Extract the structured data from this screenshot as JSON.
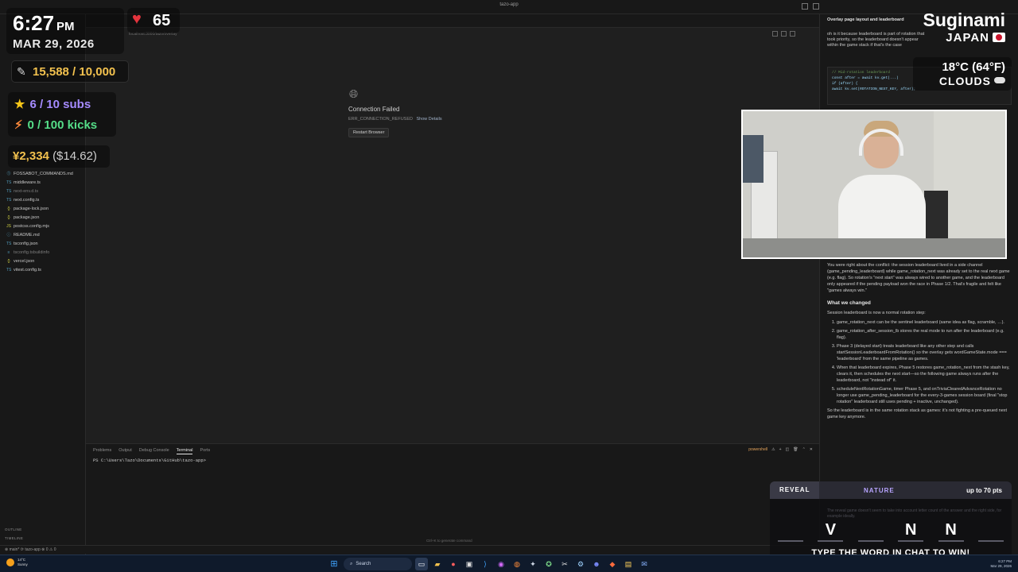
{
  "window": {
    "title": "tazo-app"
  },
  "explorer": {
    "files": [
      {
        "icon": "markdown-icon",
        "cls": "md",
        "glyph": "⓵",
        "name": "FOSSABOT_COMMANDS.md",
        "dim": false
      },
      {
        "icon": "typescript-icon",
        "cls": "ts",
        "glyph": "TS",
        "name": "middleware.ts",
        "dim": false
      },
      {
        "icon": "typescript-icon",
        "cls": "dts",
        "glyph": "TS",
        "name": "next-env.d.ts",
        "dim": true
      },
      {
        "icon": "typescript-icon",
        "cls": "ts",
        "glyph": "TS",
        "name": "next.config.ts",
        "dim": false
      },
      {
        "icon": "json-icon",
        "cls": "json",
        "glyph": "{}",
        "name": "package-lock.json",
        "dim": false
      },
      {
        "icon": "json-icon",
        "cls": "json",
        "glyph": "{}",
        "name": "package.json",
        "dim": false
      },
      {
        "icon": "js-icon",
        "cls": "mjs",
        "glyph": "JS",
        "name": "postcss.config.mjs",
        "dim": false
      },
      {
        "icon": "markdown-icon",
        "cls": "md",
        "glyph": "ⓘ",
        "name": "README.md",
        "dim": false
      },
      {
        "icon": "typescript-icon",
        "cls": "ts",
        "glyph": "TS",
        "name": "tsconfig.json",
        "dim": false
      },
      {
        "icon": "file-icon",
        "cls": "dts",
        "glyph": "≡",
        "name": "tsconfig.tsbuildinfo",
        "dim": true
      },
      {
        "icon": "json-icon",
        "cls": "json",
        "glyph": "{}",
        "name": "vercel.json",
        "dim": false
      },
      {
        "icon": "typescript-icon",
        "cls": "ts",
        "glyph": "TS",
        "name": "vitest.config.ts",
        "dim": false
      }
    ],
    "outline_label": "OUTLINE",
    "timeline_label": "TIMELINE"
  },
  "browser": {
    "url": "localhost:3000/tazo/overlay",
    "error_title": "Connection Failed",
    "error_code": "ERR_CONNECTION_REFUSED",
    "details_link": "Show Details",
    "restart_button": "Restart Browser"
  },
  "panel": {
    "tabs": [
      "Problems",
      "Output",
      "Debug Console",
      "Terminal",
      "Ports"
    ],
    "active_tab": "Terminal",
    "shell": "powershell",
    "prompt": "PS C:\\Users\\Tazo\\Documents\\GitHub\\tazo-app>",
    "hint": "Ctrl+K to generate command"
  },
  "statusbar": {
    "left": "⊗ main* ⟳  tazo-app  ⊗ 0 ⚠ 0"
  },
  "chat": {
    "header": "Overlay page layout and leaderboard",
    "message1": "oh is it because leaderboard is part of rotation that took priority, so the leaderboard doesn't appear within the game stack if that's the case",
    "code_comment": "// Mid-rotation leaderboard",
    "code_l1": "const after = await kv.get(...)",
    "code_l2": "if (after) {",
    "code_l3": "  await kv.set(ROTATION_NEXT_KEY, after);",
    "p1": "You were right about the conflict: the session leaderboard lived in a side channel (game_pending_leaderboard) while game_rotation_next was already set to the real next game (e.g. flag). So rotation's \"next start\" was always wired to another game, and the leaderboard only appeared if the pending payload won the race in Phase 1/2. That's fragile and felt like \"games always win.\"",
    "h_changed": "What we changed",
    "p2": "Session leaderboard is now a normal rotation step:",
    "items": [
      "game_rotation_next can be the sentinel leaderboard (same idea as flag, scramble, …).",
      "game_rotation_after_session_lb stores the real mode to run after the leaderboard (e.g. flag).",
      "Phase 3 (delayed start) treats leaderboard like any other step and calls startSessionLeaderboardFromRotation() so the overlay gets wordGameState.mode === 'leaderboard' from the same pipeline as games.",
      "When that leaderboard expires, Phase 5 restores game_rotation_next from the stash key, clears it, then schedules the next start—so the following game always runs after the leaderboard, not \"instead of\" it.",
      "scheduleNextRotationGame, timer Phase 5, and onTriviaClearedAdvanceRotation no longer use game_pending_leaderboard for the every-3-games session board (final \"stop rotation\" leaderboard still uses pending + inactive, unchanged)."
    ],
    "p3": "So the leaderboard is in the same rotation stack as games: it's not fighting a pre-queued next game key anymore."
  },
  "overlay": {
    "time": "6:27",
    "ampm": "PM",
    "date": "MAR 29, 2026",
    "heart_rate": "65",
    "goal": "15,588 / 10,000",
    "subs": "6 / 10 subs",
    "kicks": "0 / 100 kicks",
    "money": "¥2,334",
    "money_usd": "($14.62)",
    "name": "Suginami",
    "country": "JAPAN",
    "temp": "18°C (64°F)",
    "condition": "CLOUDS"
  },
  "game": {
    "mode": "REVEAL",
    "category": "NATURE",
    "points": "up to 70 pts",
    "hint": "The reveal game doesn't seem to take into account letter count of the answer and the right side, for example ideally.",
    "letters": [
      "",
      "V",
      "",
      "N",
      "N",
      ""
    ],
    "cta": "TYPE THE WORD IN CHAT TO WIN!"
  },
  "taskbar": {
    "weather_temp": "14°C",
    "weather_cond": "Sunny",
    "search": "Search",
    "tray_time": "6:27 PM",
    "tray_date": "Mar 29, 2026"
  },
  "colors": {
    "accent_gold": "#f2c14e",
    "subs_purple": "#a58bff",
    "kicks_green": "#55dd88",
    "heart_red": "#e3343d",
    "taskbar": "#0f1a2b"
  }
}
